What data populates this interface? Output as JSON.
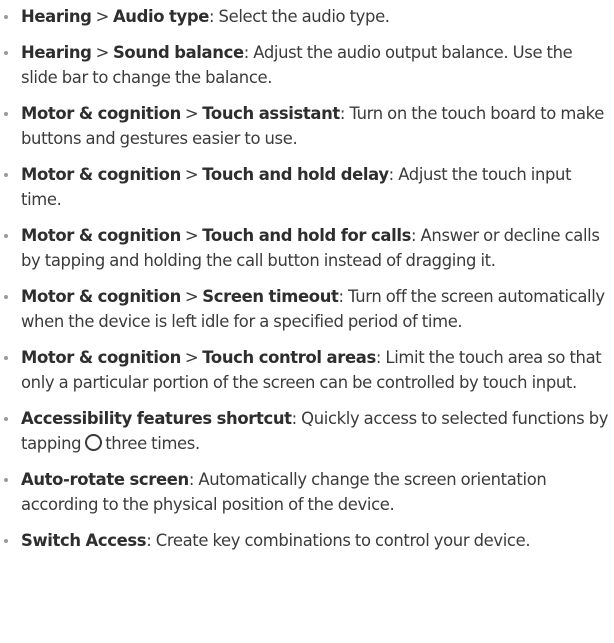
{
  "items": [
    {
      "parts": [
        "Hearing",
        "Audio type"
      ],
      "desc": ": Select the audio type."
    },
    {
      "parts": [
        "Hearing",
        "Sound balance"
      ],
      "desc": ": Adjust the audio output balance. Use the slide bar to change the balance."
    },
    {
      "parts": [
        "Motor & cognition",
        "Touch assistant"
      ],
      "desc": ": Turn on the touch board to make buttons and gestures easier to use."
    },
    {
      "parts": [
        "Motor & cognition",
        "Touch and hold delay"
      ],
      "desc": ": Adjust the touch input time."
    },
    {
      "parts": [
        "Motor & cognition",
        "Touch and hold for calls"
      ],
      "desc": ": Answer or decline calls by tapping and holding the call button instead of dragging it."
    },
    {
      "parts": [
        "Motor & cognition",
        "Screen timeout"
      ],
      "desc": ": Turn off the screen automatically when the device is left idle for a specified period of time."
    },
    {
      "parts": [
        "Motor & cognition",
        "Touch control areas"
      ],
      "desc": ": Limit the touch area so that only a particular portion of the screen can be controlled by touch input."
    },
    {
      "parts": [
        "Accessibility features shortcut"
      ],
      "desc": ": Quickly access to selected functions by tapping",
      "icon": "circle-icon",
      "desc_after": "three times."
    },
    {
      "parts": [
        "Auto-rotate screen"
      ],
      "desc": ": Automatically change the screen orientation according to the physical position of the device."
    },
    {
      "parts": [
        "Switch Access"
      ],
      "desc": ": Create key combinations to control your device."
    }
  ],
  "separator": ">"
}
